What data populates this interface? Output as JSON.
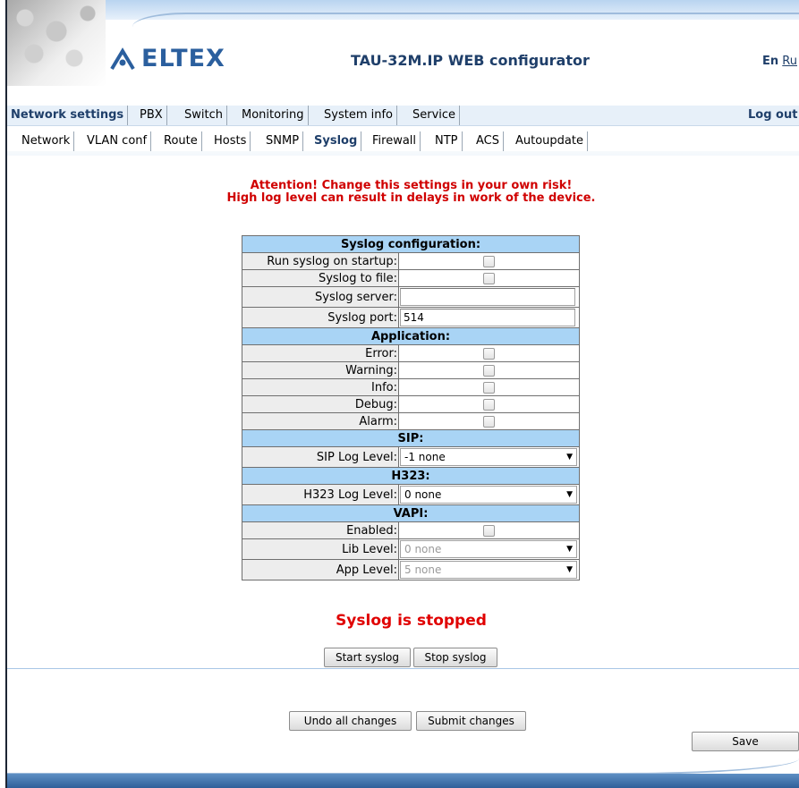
{
  "header": {
    "logo_text": "ELTEX",
    "title": "TAU-32M.IP WEB configurator",
    "lang_current": "En",
    "lang_other": "Ru"
  },
  "menu_main": {
    "items": [
      "Network settings",
      "PBX",
      "Switch",
      "Monitoring",
      "System info",
      "Service"
    ],
    "active": "Network settings",
    "logout": "Log out"
  },
  "menu_sub": {
    "items": [
      "Network",
      "VLAN conf",
      "Route",
      "Hosts",
      "SNMP",
      "Syslog",
      "Firewall",
      "NTP",
      "ACS",
      "Autoupdate"
    ],
    "active": "Syslog"
  },
  "warning": {
    "line1": "Attention! Change this settings in your own risk!",
    "line2": "High log level can result in delays in work of the device."
  },
  "syslog": {
    "section_title": "Syslog configuration:",
    "run_on_startup_label": "Run syslog on startup:",
    "to_file_label": "Syslog to file:",
    "server_label": "Syslog server:",
    "server_value": "",
    "port_label": "Syslog port:",
    "port_value": "514"
  },
  "application": {
    "section_title": "Application:",
    "error_label": "Error:",
    "warning_label": "Warning:",
    "info_label": "Info:",
    "debug_label": "Debug:",
    "alarm_label": "Alarm:"
  },
  "sip": {
    "section_title": "SIP:",
    "log_level_label": "SIP Log Level:",
    "log_level_value": "-1 none"
  },
  "h323": {
    "section_title": "H323:",
    "log_level_label": "H323 Log Level:",
    "log_level_value": "0 none"
  },
  "vapi": {
    "section_title": "VAPI:",
    "enabled_label": "Enabled:",
    "lib_level_label": "Lib Level:",
    "lib_level_value": "0 none",
    "app_level_label": "App Level:",
    "app_level_value": "5 none"
  },
  "status_text": "Syslog is stopped",
  "buttons": {
    "start": "Start syslog",
    "stop": "Stop syslog",
    "undo": "Undo all changes",
    "submit": "Submit changes",
    "save": "Save"
  },
  "colors": {
    "brand_blue": "#2b5f9e",
    "header_cell": "#a9d4f5",
    "warning_red": "#d00000"
  }
}
